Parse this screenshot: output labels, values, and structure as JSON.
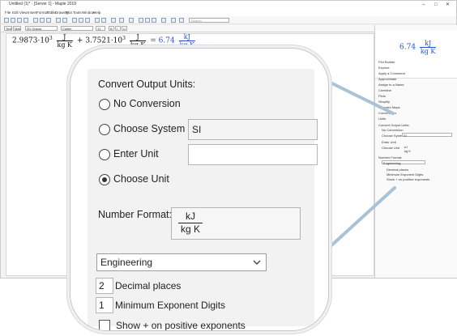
{
  "window": {
    "title": "Untitled (1)* - [Server 1] - Maple 2019",
    "controls": [
      "–",
      "□",
      "✕"
    ]
  },
  "menu": [
    "File",
    "Edit",
    "View",
    "Insert",
    "Format",
    "Table",
    "Drawing",
    "Plot",
    "Tools",
    "Window",
    "Help"
  ],
  "toolbar": {
    "mode": "Text",
    "mode_alt": "Math",
    "style_select": "2D Output",
    "font_select": "Calibri",
    "size_select": "12",
    "bold": "B",
    "italic": "I",
    "underline": "U",
    "search_placeholder": "Search"
  },
  "math_output": {
    "term1_coef": "2.9873·10",
    "term1_exp": "3",
    "term1_num": "J",
    "term1_den": "kg K",
    "plus": "+",
    "term2_coef": "3.7521·10",
    "term2_exp": "3",
    "term2_num": "J",
    "term2_den": "kg K",
    "arrow": "=",
    "result_value": "6.74",
    "result_num": "kJ",
    "result_den": "kg K"
  },
  "context_panel": {
    "preview_value": "6.74",
    "preview_num": "kJ",
    "preview_den": "kg K",
    "items": [
      "Plot Builder",
      "Explore",
      "Apply a Command",
      "Approximate",
      "Assign to a Name",
      "Combine",
      "Plots",
      "Simplify",
      "Complex Maps",
      "Conversions",
      "Units"
    ],
    "section": "Convert Output Units:",
    "mini_options": [
      "No Conversion",
      "Choose System",
      "Enter Unit",
      "Choose Unit"
    ],
    "mini_system": "SI",
    "mini_unit_num": "kJ",
    "mini_unit_den": "kg K",
    "mini_format_heading": "Number Format:",
    "mini_format": "Engineering",
    "mini_decimal": "Decimal places",
    "mini_minexp": "Minimum Exponent Digits",
    "mini_show": "Show + on positive exponents"
  },
  "zoom": {
    "convert_heading": "Convert Output Units:",
    "options": {
      "no_conversion": "No Conversion",
      "choose_system": "Choose System",
      "enter_unit": "Enter Unit",
      "choose_unit": "Choose Unit"
    },
    "selected_option": "Choose Unit",
    "system_value": "SI",
    "enter_unit_value": "",
    "unit_num": "kJ",
    "unit_den": "kg K",
    "number_format_heading": "Number Format:",
    "format_value": "Engineering",
    "decimal_places_value": "2",
    "decimal_places_label": "Decimal places",
    "min_exp_value": "1",
    "min_exp_label": "Minimum Exponent Digits",
    "show_plus_label": "Show + on positive exponents",
    "show_plus_checked": false
  },
  "colors": {
    "result_blue": "#1f4fd6",
    "connector": "#a9c3d4"
  }
}
